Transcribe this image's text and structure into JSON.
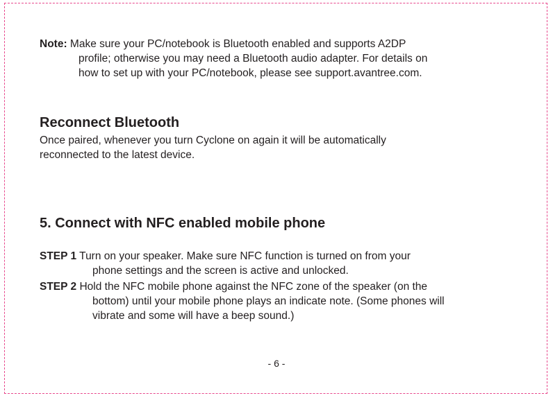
{
  "note": {
    "label": "Note:",
    "line1": "Make sure your PC/notebook is Bluetooth enabled and supports A2DP",
    "line2": "profile; otherwise you may need a Bluetooth audio adapter. For details on",
    "line3": "how to set up with your PC/notebook, please see support.avantree.com."
  },
  "reconnect": {
    "heading": "Reconnect Bluetooth",
    "line1": "Once paired, whenever you turn Cyclone on again it will be automatically",
    "line2": "reconnected to the latest device."
  },
  "nfc_section": {
    "heading": "5. Connect with NFC enabled mobile phone",
    "steps": [
      {
        "label": "STEP 1",
        "line1": "Turn on your speaker. Make sure NFC function is turned on from your",
        "line2": "phone settings and the screen is active and unlocked."
      },
      {
        "label": "STEP 2",
        "line1": "Hold the NFC mobile phone against the NFC zone of the speaker (on the",
        "line2": "bottom) until your mobile phone plays an indicate note. (Some phones will",
        "line3": "vibrate and some will have a beep sound.)"
      }
    ]
  },
  "page_number": "- 6 -",
  "colors": {
    "border": "#e8478c",
    "text": "#231f20"
  }
}
